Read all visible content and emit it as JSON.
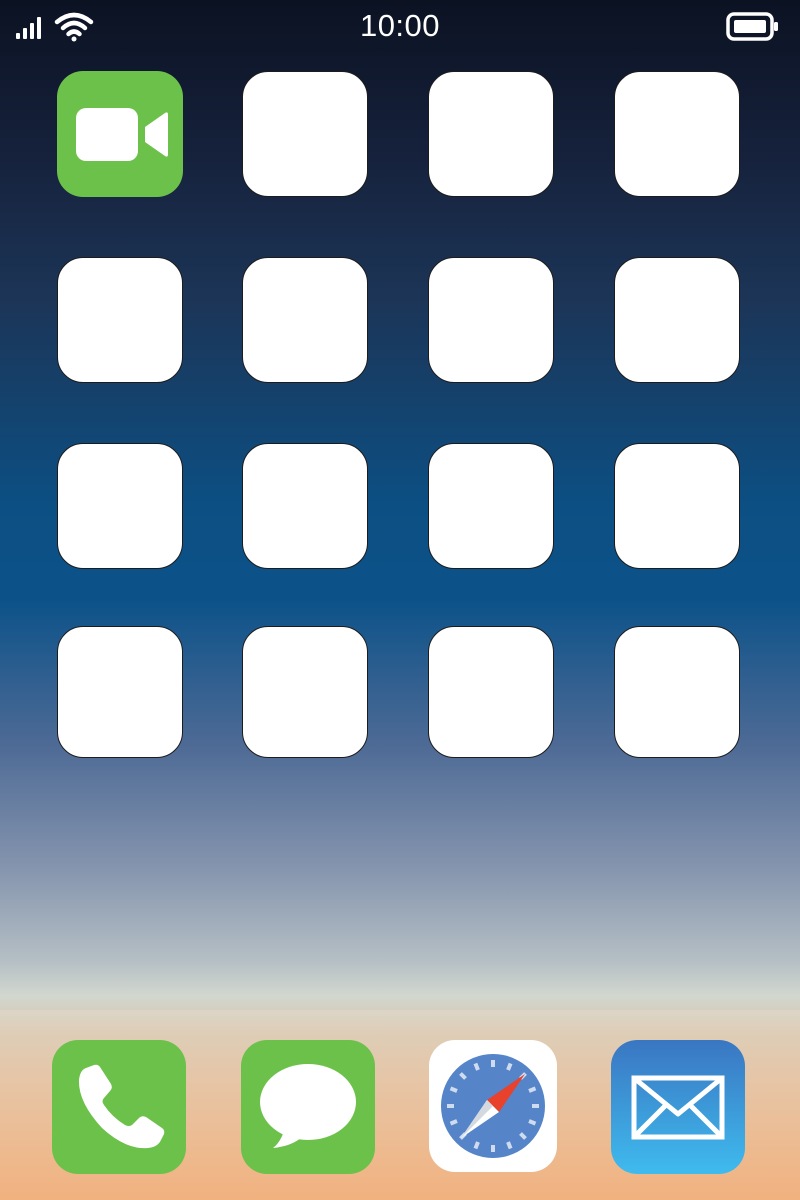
{
  "status_bar": {
    "time": "10:00",
    "signal_icon": "cellular-signal-icon",
    "wifi_icon": "wifi-icon",
    "battery_icon": "battery-full-icon"
  },
  "home_grid": {
    "rows": 4,
    "columns": 4,
    "apps": [
      {
        "name": "FaceTime",
        "icon": "facetime-video-icon",
        "color": "#6cc14a",
        "label": ""
      },
      {
        "name": "",
        "icon": "blank-app-icon",
        "color": "#ffffff",
        "label": ""
      },
      {
        "name": "",
        "icon": "blank-app-icon",
        "color": "#ffffff",
        "label": ""
      },
      {
        "name": "",
        "icon": "blank-app-icon",
        "color": "#ffffff",
        "label": ""
      },
      {
        "name": "",
        "icon": "blank-app-icon",
        "color": "#ffffff",
        "label": ""
      },
      {
        "name": "",
        "icon": "blank-app-icon",
        "color": "#ffffff",
        "label": ""
      },
      {
        "name": "",
        "icon": "blank-app-icon",
        "color": "#ffffff",
        "label": ""
      },
      {
        "name": "",
        "icon": "blank-app-icon",
        "color": "#ffffff",
        "label": ""
      },
      {
        "name": "",
        "icon": "blank-app-icon",
        "color": "#ffffff",
        "label": ""
      },
      {
        "name": "",
        "icon": "blank-app-icon",
        "color": "#ffffff",
        "label": ""
      },
      {
        "name": "",
        "icon": "blank-app-icon",
        "color": "#ffffff",
        "label": ""
      },
      {
        "name": "",
        "icon": "blank-app-icon",
        "color": "#ffffff",
        "label": ""
      },
      {
        "name": "",
        "icon": "blank-app-icon",
        "color": "#ffffff",
        "label": ""
      },
      {
        "name": "",
        "icon": "blank-app-icon",
        "color": "#ffffff",
        "label": ""
      },
      {
        "name": "",
        "icon": "blank-app-icon",
        "color": "#ffffff",
        "label": ""
      },
      {
        "name": "",
        "icon": "blank-app-icon",
        "color": "#ffffff",
        "label": ""
      }
    ]
  },
  "dock": {
    "apps": [
      {
        "icon": "phone-icon",
        "color": "#6cc14a"
      },
      {
        "icon": "messages-bubble-icon",
        "color": "#6cc14a"
      },
      {
        "icon": "safari-compass-icon",
        "color": "#ffffff"
      },
      {
        "icon": "mail-envelope-icon",
        "color": "#3a8fe0"
      }
    ]
  },
  "colors": {
    "accent_green": "#6cc14a",
    "safari_blue": "#5584c8",
    "safari_red": "#e8412c",
    "mail_top": "#3a76c2",
    "mail_bottom": "#3fbbee"
  }
}
